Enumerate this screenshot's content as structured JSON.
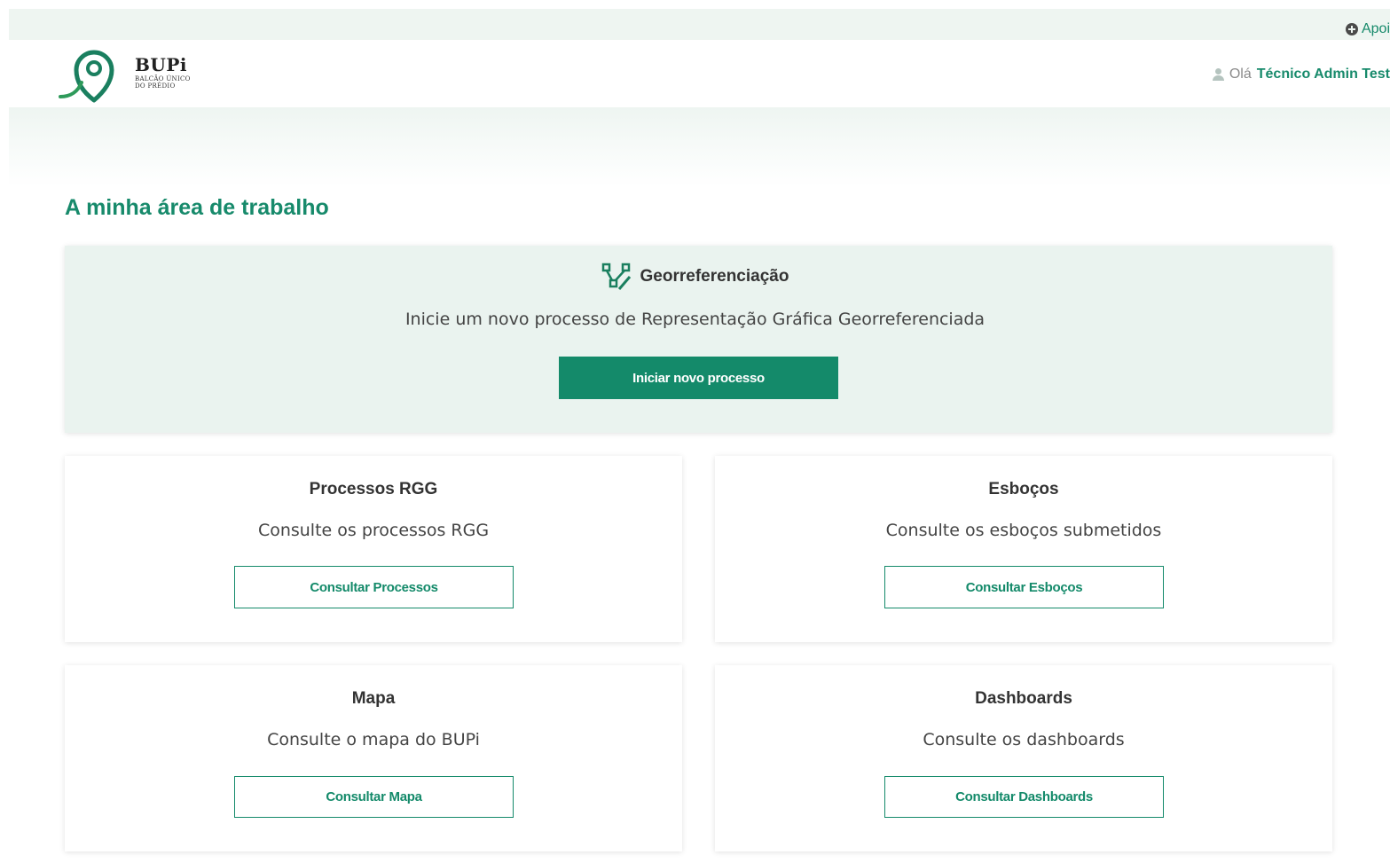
{
  "topbar": {
    "support_label": "Apoi"
  },
  "header": {
    "logo_title": "BUPi",
    "logo_sub_line1": "BALCÃO ÚNICO",
    "logo_sub_line2": "DO PRÉDIO",
    "greeting": "Olá",
    "user_name": "Técnico Admin Test"
  },
  "page": {
    "title": "A minha área de trabalho"
  },
  "georef": {
    "title": "Georreferenciação",
    "description": "Inicie um novo processo de Representação Gráfica Georreferenciada",
    "button_label": "Iniciar novo processo"
  },
  "cards": [
    {
      "title": "Processos RGG",
      "description": "Consulte os processos RGG",
      "button_label": "Consultar Processos"
    },
    {
      "title": "Esboços",
      "description": "Consulte os esboços submetidos",
      "button_label": "Consultar Esboços"
    },
    {
      "title": "Mapa",
      "description": "Consulte o mapa do BUPi",
      "button_label": "Consultar Mapa"
    },
    {
      "title": "Dashboards",
      "description": "Consulte os dashboards",
      "button_label": "Consultar Dashboards"
    }
  ],
  "colors": {
    "accent": "#148a6a",
    "accent_light": "#eaf3ef",
    "topbar_bg": "#eef5f1"
  },
  "icons": [
    "support-icon",
    "bupi-logo-icon",
    "user-icon",
    "georeference-icon"
  ]
}
